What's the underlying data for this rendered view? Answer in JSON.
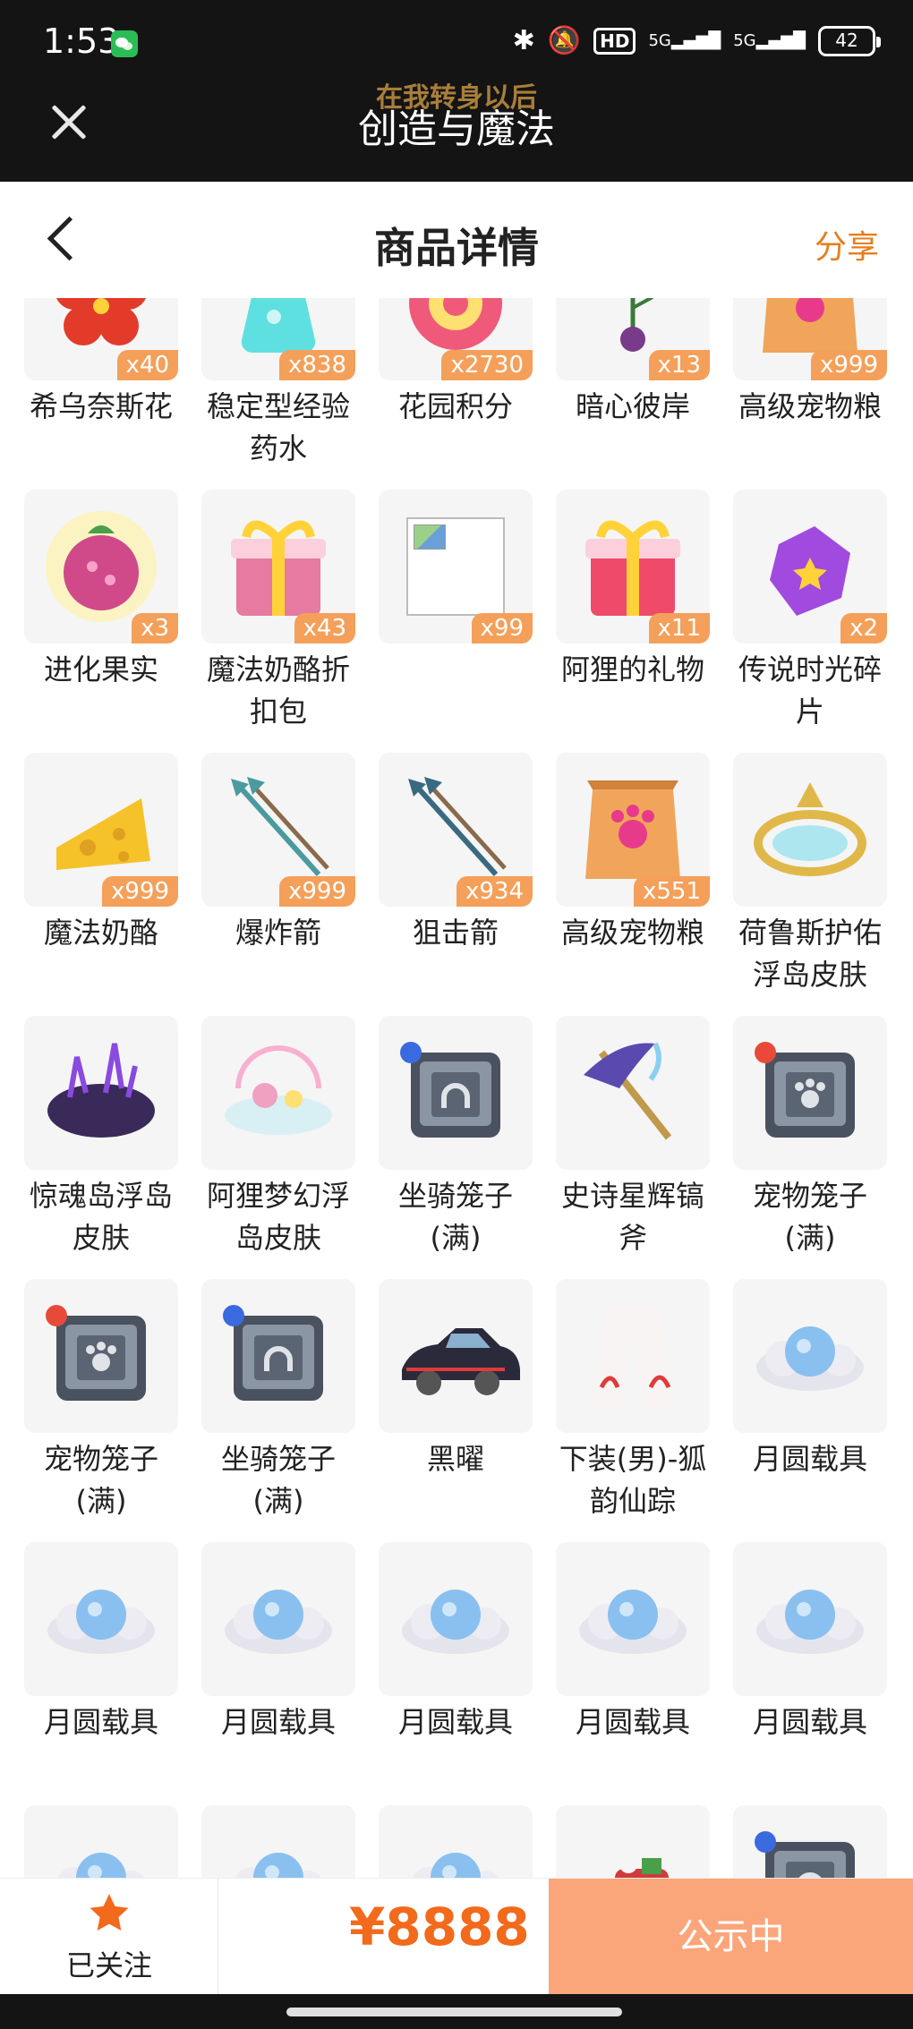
{
  "status_bar": {
    "time": "1:53",
    "hd_label": "HD",
    "signal_1": "5G",
    "signal_2": "5G",
    "battery": "42"
  },
  "miniapp": {
    "scrolling_text": "在我转身以后",
    "title": "创造与魔法"
  },
  "header": {
    "title": "商品详情",
    "share_label": "分享"
  },
  "items": [
    {
      "name": "希乌奈斯花",
      "qty": "x40",
      "icon": "red-flower-icon",
      "color": "#e33b2a"
    },
    {
      "name": "稳定型经验药水",
      "qty": "x838",
      "icon": "potion-icon",
      "color": "#5fe0e0"
    },
    {
      "name": "花园积分",
      "qty": "x2730",
      "icon": "flower-token-icon",
      "color": "#f05a7a"
    },
    {
      "name": "暗心彼岸",
      "qty": "x13",
      "icon": "dark-flower-icon",
      "color": "#7a3a8a"
    },
    {
      "name": "高级宠物粮",
      "qty": "x999",
      "icon": "pet-food-bag-icon",
      "color": "#f0a55a"
    },
    {
      "name": "进化果实",
      "qty": "x3",
      "icon": "evolution-fruit-icon",
      "color": "#d04a8a"
    },
    {
      "name": "魔法奶酪折扣包",
      "qty": "x43",
      "icon": "gift-box-icon",
      "color": "#e67aa0"
    },
    {
      "name": "",
      "qty": "x99",
      "icon": "broken-image-icon",
      "color": "#cccccc"
    },
    {
      "name": "阿狸的礼物",
      "qty": "x11",
      "icon": "gift-box-icon",
      "color": "#f04a6a"
    },
    {
      "name": "传说时光碎片",
      "qty": "x2",
      "icon": "time-shard-icon",
      "color": "#a04ae0"
    },
    {
      "name": "魔法奶酪",
      "qty": "x999",
      "icon": "cheese-icon",
      "color": "#f5c22a"
    },
    {
      "name": "爆炸箭",
      "qty": "x999",
      "icon": "arrow-icon",
      "color": "#4a9aa0"
    },
    {
      "name": "狙击箭",
      "qty": "x934",
      "icon": "arrow-icon",
      "color": "#3a6a80"
    },
    {
      "name": "高级宠物粮",
      "qty": "x551",
      "icon": "pet-food-bag-icon",
      "color": "#f0a55a"
    },
    {
      "name": "荷鲁斯护佑浮岛皮肤",
      "qty": "",
      "icon": "floating-island-frame-icon",
      "color": "#e0b84a"
    },
    {
      "name": "惊魂岛浮岛皮肤",
      "qty": "",
      "icon": "dark-island-icon",
      "color": "#3a2a5a"
    },
    {
      "name": "阿狸梦幻浮岛皮肤",
      "qty": "",
      "icon": "dream-island-icon",
      "color": "#f0a0c0"
    },
    {
      "name": "坐骑笼子(满)",
      "qty": "",
      "icon": "mount-cage-icon",
      "color": "#6a7a8a"
    },
    {
      "name": "史诗星辉镐斧",
      "qty": "",
      "icon": "pickaxe-icon",
      "color": "#5a4ab0"
    },
    {
      "name": "宠物笼子(满)",
      "qty": "",
      "icon": "pet-cage-icon",
      "color": "#6a7a8a"
    },
    {
      "name": "宠物笼子(满)",
      "qty": "",
      "icon": "pet-cage-icon",
      "color": "#6a7a8a"
    },
    {
      "name": "坐骑笼子(满)",
      "qty": "",
      "icon": "mount-cage-icon",
      "color": "#6a7a8a"
    },
    {
      "name": "黑曜",
      "qty": "",
      "icon": "car-icon",
      "color": "#2a2a3a"
    },
    {
      "name": "下装(男)-狐韵仙踪",
      "qty": "",
      "icon": "pants-icon",
      "color": "#e03a3a"
    },
    {
      "name": "月圆载具",
      "qty": "",
      "icon": "moon-cloud-icon",
      "color": "#8ac0f0"
    },
    {
      "name": "月圆载具",
      "qty": "",
      "icon": "moon-cloud-icon",
      "color": "#8ac0f0"
    },
    {
      "name": "月圆载具",
      "qty": "",
      "icon": "moon-cloud-icon",
      "color": "#8ac0f0"
    },
    {
      "name": "月圆载具",
      "qty": "",
      "icon": "moon-cloud-icon",
      "color": "#8ac0f0"
    },
    {
      "name": "月圆载具",
      "qty": "",
      "icon": "moon-cloud-icon",
      "color": "#8ac0f0"
    },
    {
      "name": "月圆载具",
      "qty": "",
      "icon": "moon-cloud-icon",
      "color": "#8ac0f0"
    },
    {
      "name": "",
      "qty": "",
      "icon": "moon-cloud-icon",
      "color": "#8ac0f0"
    },
    {
      "name": "",
      "qty": "",
      "icon": "moon-cloud-icon",
      "color": "#8ac0f0"
    },
    {
      "name": "",
      "qty": "",
      "icon": "moon-cloud-icon",
      "color": "#8ac0f0"
    },
    {
      "name": "",
      "qty": "",
      "icon": "sleigh-icon",
      "color": "#d03a3a"
    },
    {
      "name": "",
      "qty": "",
      "icon": "mount-cage-icon",
      "color": "#6a7a8a"
    }
  ],
  "bottom_bar": {
    "follow_label": "已关注",
    "price": "¥8888",
    "status_label": "公示中"
  },
  "colors": {
    "accent": "#f26a1b",
    "share": "#e67e1f",
    "status_button": "#fba57a",
    "qty_badge": "#f4a05a"
  }
}
